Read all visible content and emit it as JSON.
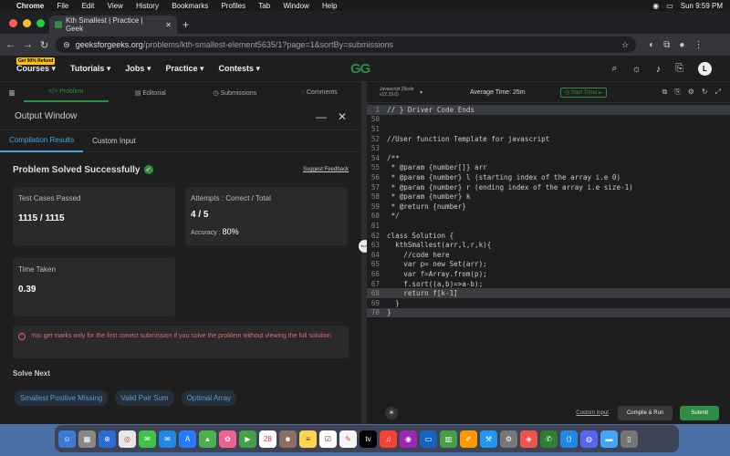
{
  "mac_menu": {
    "app": "Chrome",
    "items": [
      "File",
      "Edit",
      "View",
      "History",
      "Bookmarks",
      "Profiles",
      "Tab",
      "Window",
      "Help"
    ],
    "clock": "Sun 9:59 PM"
  },
  "browser": {
    "tab_title": "Kth Smallest | Practice | Geek",
    "url_host": "geeksforgeeks.org",
    "url_path": "/problems/kth-smallest-element5635/1?page=1&sortBy=submissions"
  },
  "site_nav": {
    "badge": "Get 90% Refund",
    "items": [
      "Courses",
      "Tutorials",
      "Jobs",
      "Practice",
      "Contests"
    ],
    "logo": "GG",
    "avatar": "L"
  },
  "problem_tabs": [
    "Problem",
    "Editorial",
    "Submissions",
    "Comments"
  ],
  "output": {
    "title": "Output Window",
    "tabs": [
      "Compilation Results",
      "Custom Input"
    ],
    "status": "Problem Solved Successfully",
    "feedback": "Suggest Feedback",
    "test_label": "Test Cases Passed",
    "test_value": "1115 / 1115",
    "attempts_label": "Attempts : Correct / Total",
    "attempts_value": "4 / 5",
    "accuracy_label": "Accuracy :",
    "accuracy_value": "80%",
    "time_label": "Time Taken",
    "time_value": "0.39",
    "warning": "You get marks only for the first correct submission if you solve the problem without viewing the full solution.",
    "solve_next": "Solve Next",
    "next_problems": [
      "Smallest Positive Missing",
      "Valid Pair Sum",
      "Optimal Array"
    ]
  },
  "editor_header": {
    "language": "Javascript (Node v12.19.0)",
    "avg_time": "Average Time: 25m",
    "start_timer": "Start Timer"
  },
  "code_lines": [
    {
      "n": "1",
      "t": "// } Driver Code Ends"
    },
    {
      "n": "50",
      "t": ""
    },
    {
      "n": "51",
      "t": ""
    },
    {
      "n": "52",
      "t": "//User function Template for javascript"
    },
    {
      "n": "53",
      "t": ""
    },
    {
      "n": "54",
      "t": "/**"
    },
    {
      "n": "55",
      "t": " * @param {number[]} arr"
    },
    {
      "n": "56",
      "t": " * @param {number} l (starting index of the array i.e 0)"
    },
    {
      "n": "57",
      "t": " * @param {number} r (ending index of the array i.e size-1)"
    },
    {
      "n": "58",
      "t": " * @param {number} k"
    },
    {
      "n": "59",
      "t": " * @return {number}"
    },
    {
      "n": "60",
      "t": " */"
    },
    {
      "n": "61",
      "t": ""
    },
    {
      "n": "62",
      "t": "class Solution {"
    },
    {
      "n": "63",
      "t": "  kthSmallest(arr,l,r,k){"
    },
    {
      "n": "64",
      "t": "    //code here"
    },
    {
      "n": "65",
      "t": "    var p= new Set(arr);"
    },
    {
      "n": "66",
      "t": "    var f=Array.from(p);"
    },
    {
      "n": "67",
      "t": "    f.sort((a,b)=>a-b);"
    },
    {
      "n": "68",
      "t": "    return f[k-1]"
    },
    {
      "n": "69",
      "t": "  }"
    },
    {
      "n": "70",
      "t": "}"
    }
  ],
  "editor_footer": {
    "custom_input": "Custom Input",
    "compile_run": "Compile & Run",
    "submit": "Submit"
  },
  "colors": {
    "accent": "#2f8d46",
    "link": "#4aa3df",
    "warning": "#e06b6b"
  }
}
